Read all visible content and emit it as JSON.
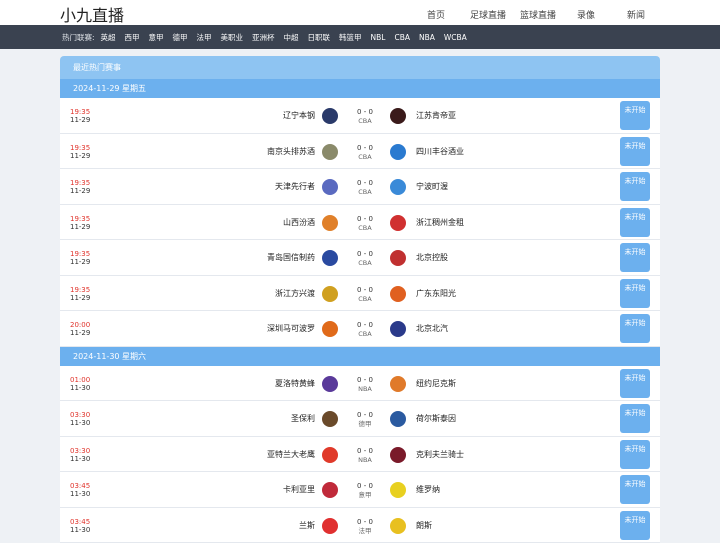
{
  "site": {
    "title": "小九直播"
  },
  "nav": [
    {
      "label": "首页"
    },
    {
      "label": "足球直播"
    },
    {
      "label": "篮球直播"
    },
    {
      "label": "录像"
    },
    {
      "label": "新闻"
    }
  ],
  "hot": {
    "label": "热门联赛:",
    "leagues": [
      "英超",
      "西甲",
      "意甲",
      "德甲",
      "法甲",
      "美职业",
      "亚洲杯",
      "中超",
      "日职联",
      "韩篮甲",
      "NBL",
      "CBA",
      "NBA",
      "WCBA"
    ]
  },
  "section_title": "最近热门赛事",
  "days": [
    {
      "date": "2024-11-29 星期五",
      "matches": [
        {
          "time": "19:35",
          "date": "11-29",
          "home": "辽宁本钢",
          "away": "江苏肯帝亚",
          "score": "0 - 0",
          "league": "CBA",
          "status": "未开始",
          "home_color": "#2a3a6a",
          "away_color": "#3a1a1a"
        },
        {
          "time": "19:35",
          "date": "11-29",
          "home": "南京头排苏酒",
          "away": "四川丰谷酒业",
          "score": "0 - 0",
          "league": "CBA",
          "status": "未开始",
          "home_color": "#8a8a6a",
          "away_color": "#2a7ad0"
        },
        {
          "time": "19:35",
          "date": "11-29",
          "home": "天津先行者",
          "away": "宁波町渥",
          "score": "0 - 0",
          "league": "CBA",
          "status": "未开始",
          "home_color": "#5a6ac0",
          "away_color": "#3a8ad8"
        },
        {
          "time": "19:35",
          "date": "11-29",
          "home": "山西汾酒",
          "away": "浙江稠州金租",
          "score": "0 - 0",
          "league": "CBA",
          "status": "未开始",
          "home_color": "#e0802a",
          "away_color": "#d03030"
        },
        {
          "time": "19:35",
          "date": "11-29",
          "home": "青岛国信制药",
          "away": "北京控股",
          "score": "0 - 0",
          "league": "CBA",
          "status": "未开始",
          "home_color": "#2a4aa0",
          "away_color": "#c03030"
        },
        {
          "time": "19:35",
          "date": "11-29",
          "home": "浙江方兴渡",
          "away": "广东东阳光",
          "score": "0 - 0",
          "league": "CBA",
          "status": "未开始",
          "home_color": "#d0a020",
          "away_color": "#e06020"
        },
        {
          "time": "20:00",
          "date": "11-29",
          "home": "深圳马可波罗",
          "away": "北京北汽",
          "score": "0 - 0",
          "league": "CBA",
          "status": "未开始",
          "home_color": "#e06a1a",
          "away_color": "#2a3a8a"
        }
      ]
    },
    {
      "date": "2024-11-30 星期六",
      "matches": [
        {
          "time": "01:00",
          "date": "11-30",
          "home": "夏洛特黄蜂",
          "away": "纽约尼克斯",
          "score": "0 - 0",
          "league": "NBA",
          "status": "未开始",
          "home_color": "#5a3a9a",
          "away_color": "#e07a2a"
        },
        {
          "time": "03:30",
          "date": "11-30",
          "home": "圣保利",
          "away": "荷尔斯泰因",
          "score": "0 - 0",
          "league": "德甲",
          "status": "未开始",
          "home_color": "#6a4a2a",
          "away_color": "#2a5aa0"
        },
        {
          "time": "03:30",
          "date": "11-30",
          "home": "亚特兰大老鹰",
          "away": "克利夫兰骑士",
          "score": "0 - 0",
          "league": "NBA",
          "status": "未开始",
          "home_color": "#e03a2a",
          "away_color": "#7a1a2a"
        },
        {
          "time": "03:45",
          "date": "11-30",
          "home": "卡利亚里",
          "away": "维罗纳",
          "score": "0 - 0",
          "league": "意甲",
          "status": "未开始",
          "home_color": "#c02a3a",
          "away_color": "#e8d020"
        },
        {
          "time": "03:45",
          "date": "11-30",
          "home": "兰斯",
          "away": "朗斯",
          "score": "0 - 0",
          "league": "法甲",
          "status": "未开始",
          "home_color": "#e03030",
          "away_color": "#e8c020"
        }
      ]
    }
  ]
}
